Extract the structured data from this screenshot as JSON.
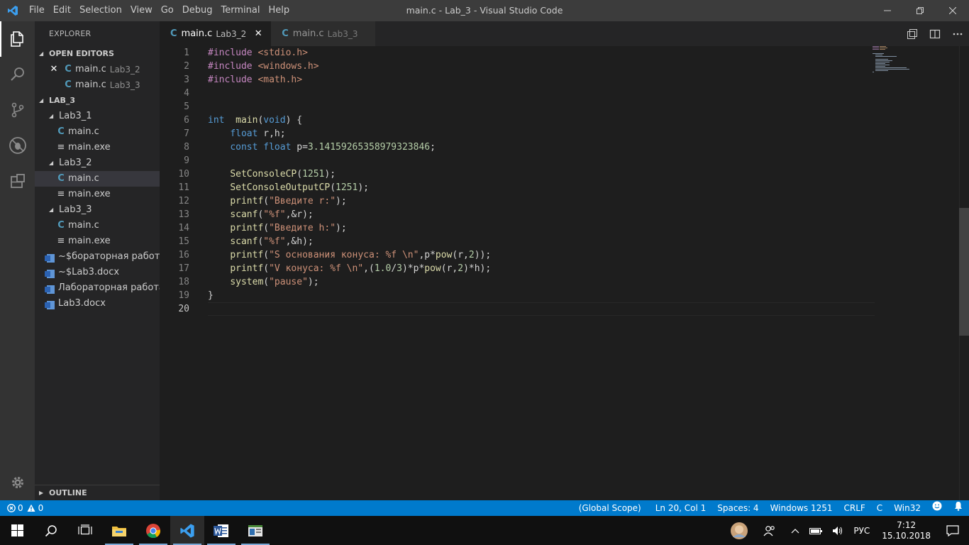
{
  "window": {
    "title": "main.c - Lab_3 - Visual Studio Code",
    "menu": [
      "File",
      "Edit",
      "Selection",
      "View",
      "Go",
      "Debug",
      "Terminal",
      "Help"
    ]
  },
  "activity": [
    "explorer-icon",
    "search-icon",
    "source-control-icon",
    "debug-icon",
    "extensions-icon",
    "gear-icon"
  ],
  "sidebar": {
    "title": "EXPLORER",
    "open_editors": {
      "header": "OPEN EDITORS",
      "items": [
        {
          "name": "main.c",
          "desc": "Lab3_2"
        },
        {
          "name": "main.c",
          "desc": "Lab3_3"
        }
      ]
    },
    "folder": {
      "header": "LAB_3",
      "groups": [
        {
          "name": "Lab3_1",
          "files": [
            "main.c",
            "main.exe"
          ]
        },
        {
          "name": "Lab3_2",
          "files": [
            "main.c",
            "main.exe"
          ]
        },
        {
          "name": "Lab3_3",
          "files": [
            "main.c",
            "main.exe"
          ]
        }
      ],
      "docs": [
        "~$бораторная работа...",
        "~$Lab3.docx",
        "Лабораторная работа...",
        "Lab3.docx"
      ]
    },
    "outline": "OUTLINE"
  },
  "tabs": [
    {
      "name": "main.c",
      "desc": "Lab3_2",
      "close": "✕"
    },
    {
      "name": "main.c",
      "desc": "Lab3_3"
    }
  ],
  "editor": {
    "lines": [
      [
        [
          "pp",
          "#include "
        ],
        [
          "str",
          "<stdio.h>"
        ]
      ],
      [
        [
          "pp",
          "#include "
        ],
        [
          "str",
          "<windows.h>"
        ]
      ],
      [
        [
          "pp",
          "#include "
        ],
        [
          "str",
          "<math.h>"
        ]
      ],
      [],
      [],
      [
        [
          "kw",
          "int"
        ],
        [
          "",
          "  "
        ],
        [
          "fn",
          "main"
        ],
        [
          "",
          "("
        ],
        [
          "kw",
          "void"
        ],
        [
          "",
          ") {"
        ]
      ],
      [
        [
          "",
          "    "
        ],
        [
          "kw",
          "float"
        ],
        [
          "",
          " r,h;"
        ]
      ],
      [
        [
          "",
          "    "
        ],
        [
          "kw",
          "const"
        ],
        [
          "",
          " "
        ],
        [
          "kw",
          "float"
        ],
        [
          "",
          " p="
        ],
        [
          "num",
          "3.14159265358979323846"
        ],
        [
          "",
          ";"
        ]
      ],
      [],
      [
        [
          "",
          "    "
        ],
        [
          "fn",
          "SetConsoleCP"
        ],
        [
          "",
          "("
        ],
        [
          "num",
          "1251"
        ],
        [
          "",
          ");"
        ]
      ],
      [
        [
          "",
          "    "
        ],
        [
          "fn",
          "SetConsoleOutputCP"
        ],
        [
          "",
          "("
        ],
        [
          "num",
          "1251"
        ],
        [
          "",
          ");"
        ]
      ],
      [
        [
          "",
          "    "
        ],
        [
          "fn",
          "printf"
        ],
        [
          "",
          "("
        ],
        [
          "str",
          "\"Введите r:\""
        ],
        [
          "",
          ");"
        ]
      ],
      [
        [
          "",
          "    "
        ],
        [
          "fn",
          "scanf"
        ],
        [
          "",
          "("
        ],
        [
          "str",
          "\"%f\""
        ],
        [
          "",
          ",&r);"
        ]
      ],
      [
        [
          "",
          "    "
        ],
        [
          "fn",
          "printf"
        ],
        [
          "",
          "("
        ],
        [
          "str",
          "\"Введите h:\""
        ],
        [
          "",
          ");"
        ]
      ],
      [
        [
          "",
          "    "
        ],
        [
          "fn",
          "scanf"
        ],
        [
          "",
          "("
        ],
        [
          "str",
          "\"%f\""
        ],
        [
          "",
          ",&h);"
        ]
      ],
      [
        [
          "",
          "    "
        ],
        [
          "fn",
          "printf"
        ],
        [
          "",
          "("
        ],
        [
          "str",
          "\"S основания конуса: %f \\n\""
        ],
        [
          "",
          ",p*"
        ],
        [
          "fn",
          "pow"
        ],
        [
          "",
          "(r,"
        ],
        [
          "num",
          "2"
        ],
        [
          "",
          "));"
        ]
      ],
      [
        [
          "",
          "    "
        ],
        [
          "fn",
          "printf"
        ],
        [
          "",
          "("
        ],
        [
          "str",
          "\"V конуса: %f \\n\""
        ],
        [
          "",
          ",("
        ],
        [
          "num",
          "1.0"
        ],
        [
          "",
          "/"
        ],
        [
          "num",
          "3"
        ],
        [
          "",
          ")*p*"
        ],
        [
          "fn",
          "pow"
        ],
        [
          "",
          "(r,"
        ],
        [
          "num",
          "2"
        ],
        [
          "",
          ")*h);"
        ]
      ],
      [
        [
          "",
          "    "
        ],
        [
          "fn",
          "system"
        ],
        [
          "",
          "("
        ],
        [
          "str",
          "\"pause\""
        ],
        [
          "",
          ");"
        ]
      ],
      [
        [
          "",
          "}"
        ]
      ],
      []
    ],
    "current_line": 20
  },
  "status": {
    "errors": "0",
    "warnings": "0",
    "scope": "(Global Scope)",
    "position": "Ln 20, Col 1",
    "spaces": "Spaces: 4",
    "encoding": "Windows 1251",
    "eol": "CRLF",
    "language": "C",
    "platform": "Win32"
  },
  "taskbar": {
    "apps": [
      "start-icon",
      "search-icon",
      "task-view-icon",
      "file-explorer-icon",
      "chrome-icon",
      "vscode-icon",
      "word-icon",
      "app-icon"
    ],
    "lang": "РУС",
    "time": "7:12",
    "date": "15.10.2018"
  },
  "colors": {
    "accent": "#007acc",
    "keyword": "#569cd6",
    "string": "#ce9178",
    "number": "#b5cea8",
    "function": "#dcdcaa",
    "preprocessor": "#c586c0"
  }
}
